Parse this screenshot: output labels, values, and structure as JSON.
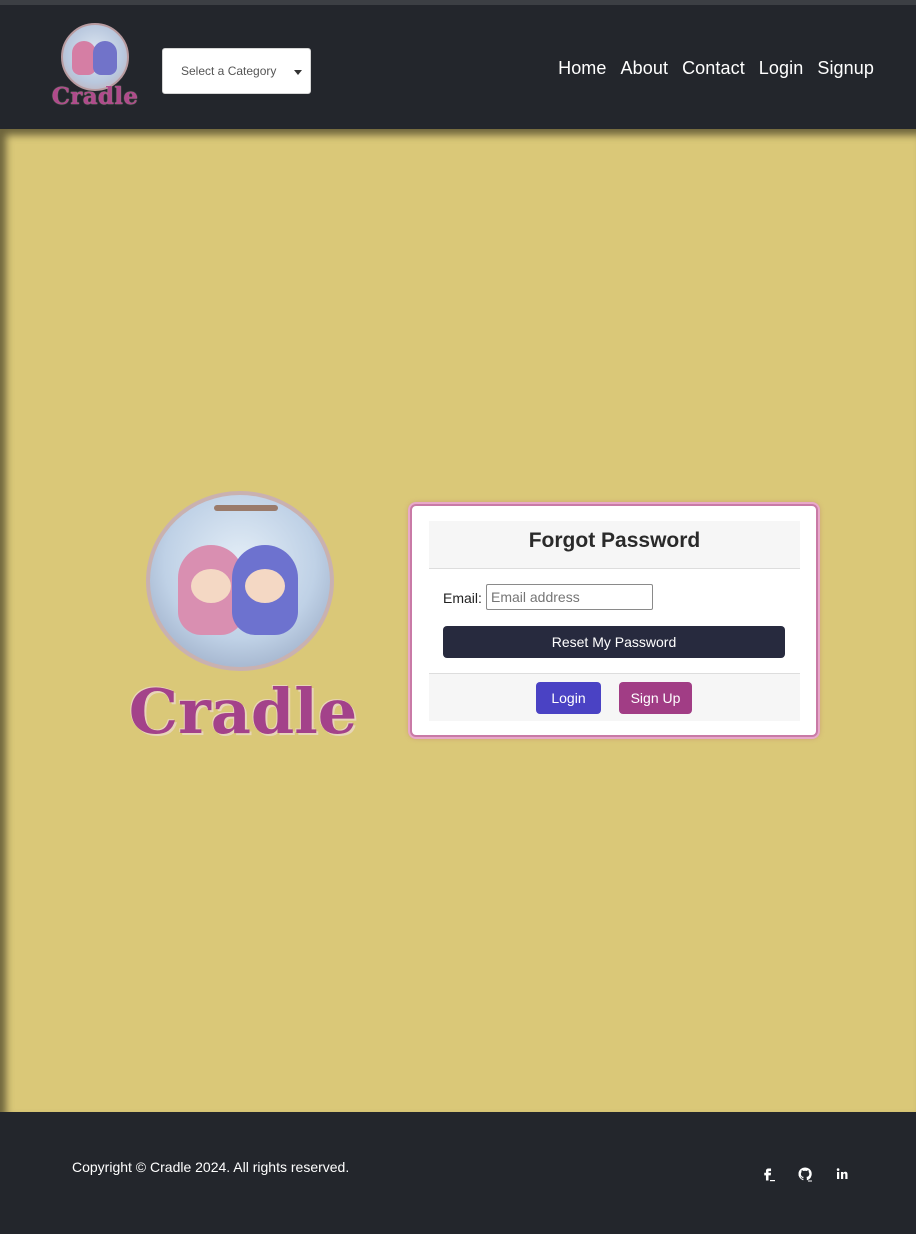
{
  "brand": {
    "name": "Cradle"
  },
  "nav": {
    "category_placeholder": "Select a Category",
    "links": [
      "Home",
      "About",
      "Contact",
      "Login",
      "Signup"
    ]
  },
  "hero": {
    "logo_text": "Cradle"
  },
  "form": {
    "title": "Forgot Password",
    "email_label": "Email:",
    "email_placeholder": "Email address",
    "email_value": "",
    "reset_label": "Reset My Password",
    "login_label": "Login",
    "signup_label": "Sign Up"
  },
  "footer": {
    "copyright": "Copyright © Cradle 2024. All rights reserved.",
    "social_icons": [
      "facebook-icon",
      "github-icon",
      "linkedin-icon"
    ]
  },
  "colors": {
    "navbar_bg": "#23262c",
    "main_bg": "#dac878",
    "reset_button": "#272a3e",
    "login_button": "#4a42c4",
    "signup_button": "#a13d85",
    "brand_text": "#a3428a"
  }
}
